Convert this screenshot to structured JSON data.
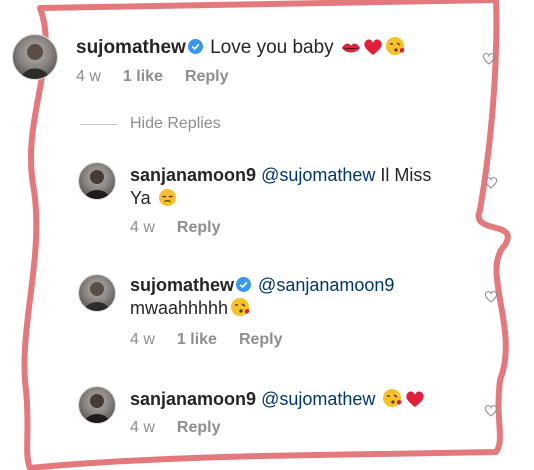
{
  "comments": [
    {
      "username": "sujomathew",
      "verified": true,
      "text": "Love you baby",
      "time": "4 w",
      "likes": "1 like",
      "reply": "Reply"
    },
    {
      "username": "sanjanamoon9",
      "mention": "@sujomathew",
      "text_line1": "Il Miss",
      "text_line2": "Ya",
      "time": "4 w",
      "reply": "Reply"
    },
    {
      "username": "sujomathew",
      "verified": true,
      "mention": "@sanjanamoon9",
      "text_line2": "mwaahhhhh",
      "time": "4 w",
      "likes": "1 like",
      "reply": "Reply"
    },
    {
      "username": "sanjanamoon9",
      "mention": "@sujomathew",
      "time": "4 w",
      "reply": "Reply"
    }
  ],
  "hide_replies": "Hide Replies",
  "icons": {
    "verified": "verified-badge-icon",
    "like": "heart-outline-icon",
    "emojis": [
      "kiss-mark-icon",
      "red-heart-icon",
      "face-blowing-kiss-icon",
      "pensive-face-icon"
    ]
  },
  "colors": {
    "username": "#262626",
    "mention": "#00376b",
    "meta": "#8e8e8e",
    "verified": "#3897f0",
    "scribble": "#e4797d"
  }
}
